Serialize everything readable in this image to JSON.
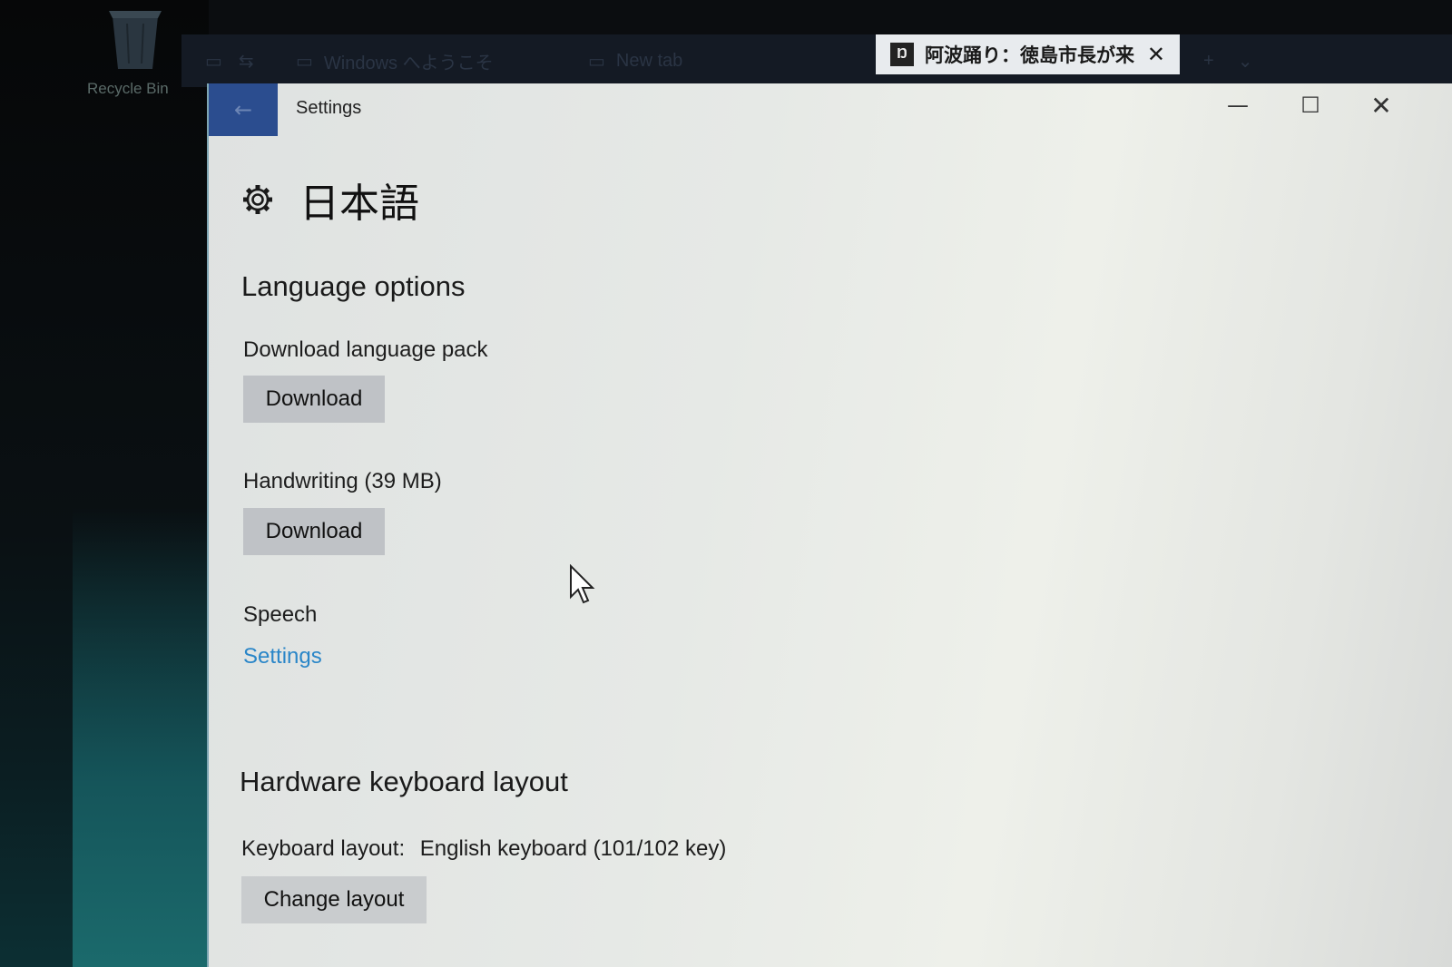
{
  "desktop": {
    "recycle_bin_label": "Recycle Bin"
  },
  "browser": {
    "tabs": [
      {
        "label": "Windows へようこそ"
      },
      {
        "label": "New tab"
      },
      {
        "label": "阿波踊り：徳島市長が来"
      }
    ]
  },
  "window": {
    "title": "Settings"
  },
  "page": {
    "title": "日本語",
    "language_options": {
      "heading": "Language options",
      "language_pack_label": "Download language pack",
      "language_pack_button": "Download",
      "handwriting_label": "Handwriting (39 MB)",
      "handwriting_button": "Download",
      "speech_label": "Speech",
      "speech_link": "Settings"
    },
    "keyboard": {
      "heading": "Hardware keyboard layout",
      "layout_label": "Keyboard layout:",
      "layout_value": "English keyboard (101/102 key)",
      "change_button": "Change layout"
    }
  },
  "colors": {
    "accent_blue": "#2b4d8f",
    "link": "#2a86c8",
    "button_bg": "#bfc2c6"
  }
}
